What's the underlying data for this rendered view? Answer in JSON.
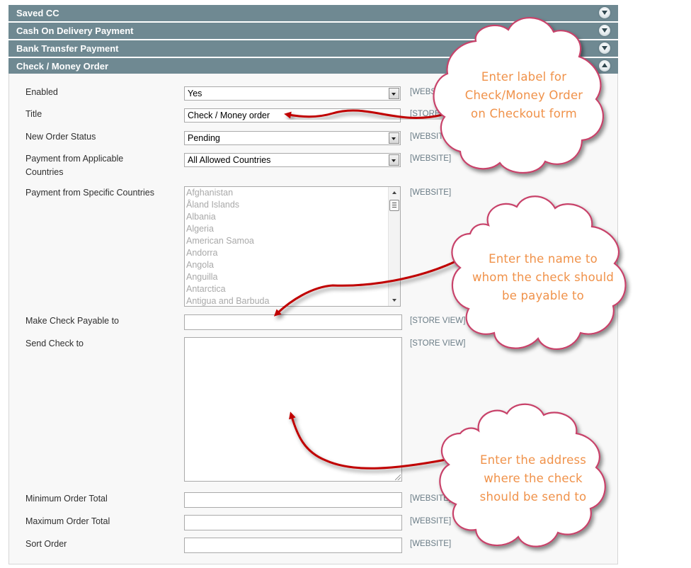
{
  "sections": [
    {
      "title": "Saved CC",
      "state": "collapsed"
    },
    {
      "title": "Cash On Delivery Payment",
      "state": "collapsed"
    },
    {
      "title": "Bank Transfer Payment",
      "state": "collapsed"
    },
    {
      "title": "Check / Money Order",
      "state": "expanded"
    }
  ],
  "form": {
    "enabled": {
      "label": "Enabled",
      "value": "Yes",
      "scope": "[WEBSITE]"
    },
    "title": {
      "label": "Title",
      "value": "Check / Money order",
      "scope": "[STORE VIEW]"
    },
    "new_order_status": {
      "label": "New Order Status",
      "value": "Pending",
      "scope": "[WEBSITE]"
    },
    "applicable_countries": {
      "label": "Payment from Applicable Countries",
      "value": "All Allowed Countries",
      "scope": "[WEBSITE]"
    },
    "specific_countries": {
      "label": "Payment from Specific Countries",
      "scope": "[WEBSITE]",
      "options": [
        "Afghanistan",
        "Åland Islands",
        "Albania",
        "Algeria",
        "American Samoa",
        "Andorra",
        "Angola",
        "Anguilla",
        "Antarctica",
        "Antigua and Barbuda"
      ]
    },
    "payable_to": {
      "label": "Make Check Payable to",
      "value": "",
      "scope": "[STORE VIEW]"
    },
    "send_check_to": {
      "label": "Send Check to",
      "value": "",
      "scope": "[STORE VIEW]"
    },
    "min_order_total": {
      "label": "Minimum Order Total",
      "value": "",
      "scope": "[WEBSITE]"
    },
    "max_order_total": {
      "label": "Maximum Order Total",
      "value": "",
      "scope": "[WEBSITE]"
    },
    "sort_order": {
      "label": "Sort Order",
      "value": "",
      "scope": "[WEBSITE]"
    }
  },
  "callouts": [
    {
      "lines": [
        "Enter label for",
        "Check/Money Order",
        "on Checkout form"
      ]
    },
    {
      "lines": [
        "Enter the name to",
        "whom the check should",
        "be payable to"
      ]
    },
    {
      "lines": [
        "Enter the address",
        "where the check",
        "should be send to"
      ]
    }
  ],
  "colors": {
    "section_header": "#6f8992",
    "callout_text": "#f0924a",
    "callout_border": "#c8436a",
    "arrow": "#c00000",
    "scope_text": "#6a7c86"
  }
}
